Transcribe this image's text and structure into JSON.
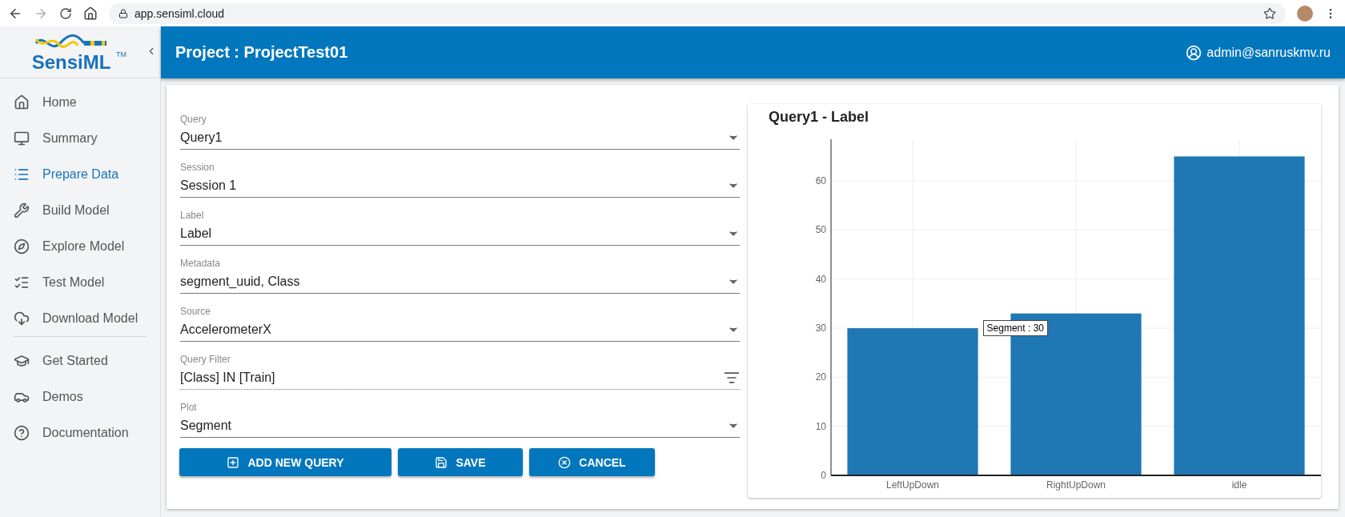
{
  "browser": {
    "url": "app.sensiml.cloud",
    "forward_disabled": true
  },
  "logo": {
    "text": "SensiML",
    "trademark": "TM"
  },
  "header": {
    "title": "Project : ProjectTest01",
    "user": "admin@sanruskmv.ru"
  },
  "sidebar": {
    "items": [
      {
        "label": "Home",
        "selected": false
      },
      {
        "label": "Summary",
        "selected": false
      },
      {
        "label": "Prepare Data",
        "selected": true
      },
      {
        "label": "Build Model",
        "selected": false
      },
      {
        "label": "Explore Model",
        "selected": false
      },
      {
        "label": "Test Model",
        "selected": false
      },
      {
        "label": "Download Model",
        "selected": false
      }
    ],
    "secondary_items": [
      {
        "label": "Get Started",
        "selected": false
      },
      {
        "label": "Demos",
        "selected": false
      },
      {
        "label": "Documentation",
        "selected": false
      }
    ]
  },
  "form": {
    "fields": [
      {
        "kind": "select",
        "label": "Query",
        "value": "Query1"
      },
      {
        "kind": "select",
        "label": "Session",
        "value": "Session 1"
      },
      {
        "kind": "select",
        "label": "Label",
        "value": "Label"
      },
      {
        "kind": "select",
        "label": "Metadata",
        "value": "segment_uuid, Class"
      },
      {
        "kind": "select",
        "label": "Source",
        "value": "AccelerometerX"
      },
      {
        "kind": "filter",
        "label": "Query Filter",
        "value": "[Class] IN [Train]"
      },
      {
        "kind": "select",
        "label": "Plot",
        "value": "Segment"
      }
    ],
    "buttons": [
      {
        "kind": "add",
        "label": "ADD NEW QUERY"
      },
      {
        "kind": "save",
        "label": "SAVE"
      },
      {
        "kind": "cancel",
        "label": "CANCEL"
      }
    ]
  },
  "chart": {
    "title": "Query1 - Label",
    "tooltip": "Segment : 30",
    "chart_data": {
      "type": "bar",
      "grid": true,
      "categories": [
        "LeftUpDown",
        "RightUpDown",
        "idle"
      ],
      "series": [
        {
          "color": "#1f77b4",
          "values": [
            30,
            33,
            65
          ]
        }
      ],
      "ylim": [
        0,
        68.5
      ],
      "yticks": [
        0,
        10,
        20,
        30,
        40,
        50,
        60
      ]
    }
  }
}
